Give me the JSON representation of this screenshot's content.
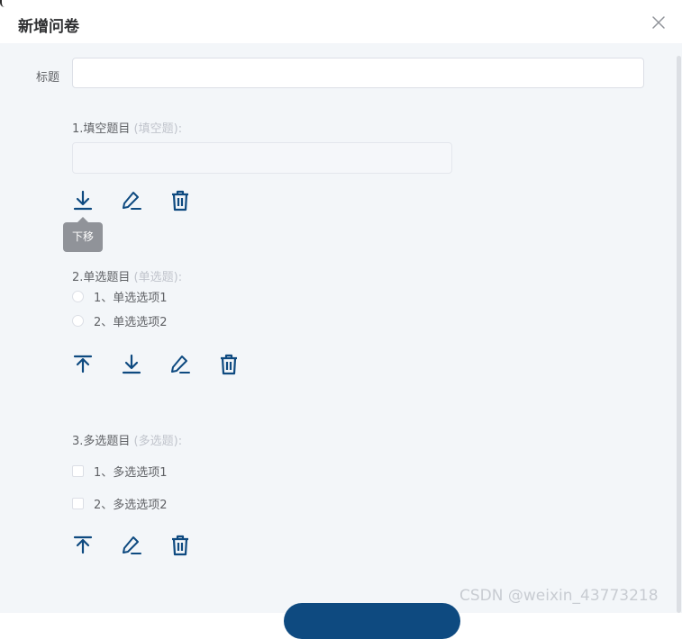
{
  "dialog": {
    "title": "新增问卷",
    "close_icon": "close-icon"
  },
  "form": {
    "title_label": "标题",
    "title_value": "",
    "title_placeholder": ""
  },
  "questions": [
    {
      "title": "1.填空题目",
      "type_label": "(填空题):",
      "input_value": "",
      "icons": [
        "move-down-icon",
        "edit-icon",
        "delete-icon"
      ],
      "tooltip": "下移"
    },
    {
      "title": "2.单选题目",
      "type_label": "(单选题):",
      "options": [
        "1、单选选项1",
        "2、单选选项2"
      ],
      "icons": [
        "move-up-icon",
        "move-down-icon",
        "edit-icon",
        "delete-icon"
      ]
    },
    {
      "title": "3.多选题目",
      "type_label": "(多选题):",
      "options": [
        "1、多选选项1",
        "2、多选选项2"
      ],
      "icons": [
        "move-up-icon",
        "edit-icon",
        "delete-icon"
      ]
    }
  ],
  "watermark": "CSDN @weixin_43773218",
  "colors": {
    "accent": "#0e4a80",
    "background": "#f3f6f9",
    "tooltip": "#909399",
    "muted_text": "#c0c4cc"
  }
}
